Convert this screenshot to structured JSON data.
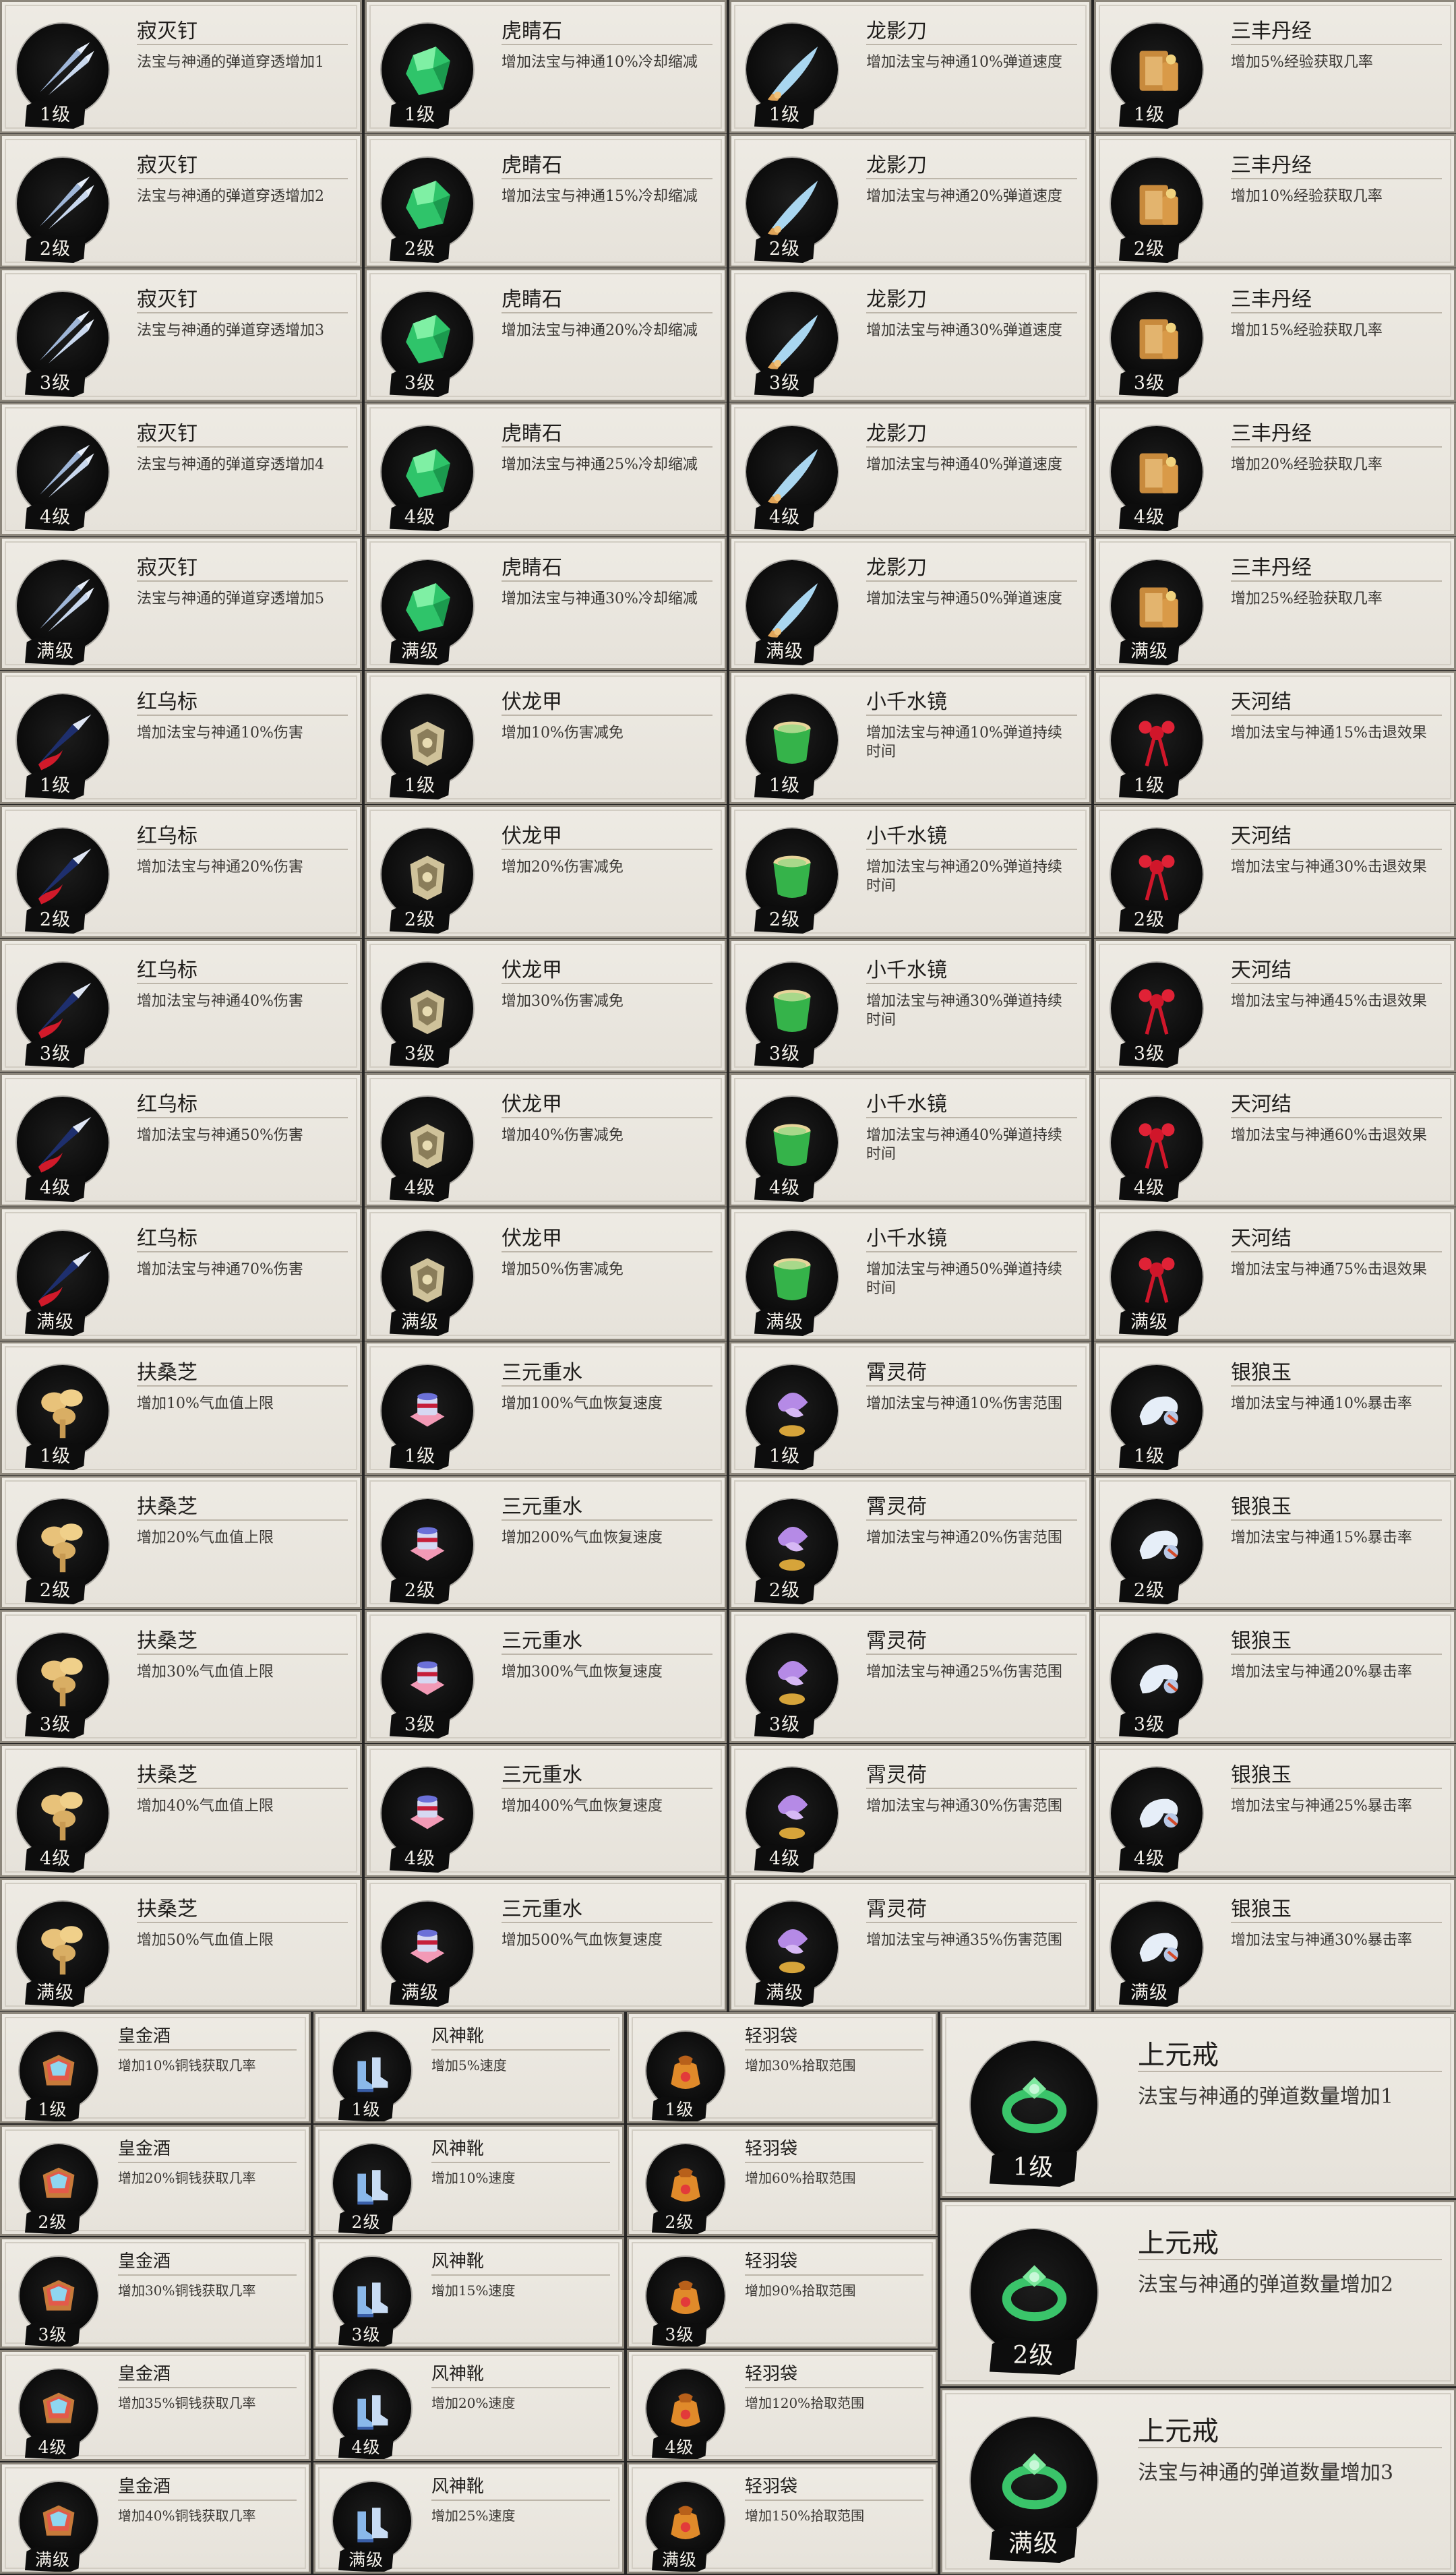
{
  "colors": {
    "sheet_bg": "#262524",
    "card_bg": "#ebe7df",
    "badge_bg": "#0d0d0d",
    "badge_text": "#f4f1ea"
  },
  "groups": [
    {
      "items": [
        {
          "name": "寂灭钉",
          "icon": "spike-darts-icon",
          "levels": [
            {
              "level": "1级",
              "desc": "法宝与神通的弹道穿透增加1"
            },
            {
              "level": "2级",
              "desc": "法宝与神通的弹道穿透增加2"
            },
            {
              "level": "3级",
              "desc": "法宝与神通的弹道穿透增加3"
            },
            {
              "level": "4级",
              "desc": "法宝与神通的弹道穿透增加4"
            },
            {
              "level": "满级",
              "desc": "法宝与神通的弹道穿透增加5"
            }
          ]
        },
        {
          "name": "虎睛石",
          "icon": "green-gem-icon",
          "levels": [
            {
              "level": "1级",
              "desc": "增加法宝与神通10%冷却缩减"
            },
            {
              "level": "2级",
              "desc": "增加法宝与神通15%冷却缩减"
            },
            {
              "level": "3级",
              "desc": "增加法宝与神通20%冷却缩减"
            },
            {
              "level": "4级",
              "desc": "增加法宝与神通25%冷却缩减"
            },
            {
              "level": "满级",
              "desc": "增加法宝与神通30%冷却缩减"
            }
          ]
        },
        {
          "name": "龙影刀",
          "icon": "blade-icon",
          "levels": [
            {
              "level": "1级",
              "desc": "增加法宝与神通10%弹道速度"
            },
            {
              "level": "2级",
              "desc": "增加法宝与神通20%弹道速度"
            },
            {
              "level": "3级",
              "desc": "增加法宝与神通30%弹道速度"
            },
            {
              "level": "4级",
              "desc": "增加法宝与神通40%弹道速度"
            },
            {
              "level": "满级",
              "desc": "增加法宝与神通50%弹道速度"
            }
          ]
        },
        {
          "name": "三丰丹经",
          "icon": "scroll-icon",
          "levels": [
            {
              "level": "1级",
              "desc": "增加5%经验获取几率"
            },
            {
              "level": "2级",
              "desc": "增加10%经验获取几率"
            },
            {
              "level": "3级",
              "desc": "增加15%经验获取几率"
            },
            {
              "level": "4级",
              "desc": "增加20%经验获取几率"
            },
            {
              "level": "满级",
              "desc": "增加25%经验获取几率"
            }
          ]
        }
      ]
    },
    {
      "items": [
        {
          "name": "红乌标",
          "icon": "red-dart-icon",
          "levels": [
            {
              "level": "1级",
              "desc": "增加法宝与神通10%伤害"
            },
            {
              "level": "2级",
              "desc": "增加法宝与神通20%伤害"
            },
            {
              "level": "3级",
              "desc": "增加法宝与神通40%伤害"
            },
            {
              "level": "4级",
              "desc": "增加法宝与神通50%伤害"
            },
            {
              "level": "满级",
              "desc": "增加法宝与神通70%伤害"
            }
          ]
        },
        {
          "name": "伏龙甲",
          "icon": "armor-icon",
          "levels": [
            {
              "level": "1级",
              "desc": "增加10%伤害减免"
            },
            {
              "level": "2级",
              "desc": "增加20%伤害减免"
            },
            {
              "level": "3级",
              "desc": "增加30%伤害减免"
            },
            {
              "level": "4级",
              "desc": "增加40%伤害减免"
            },
            {
              "level": "满级",
              "desc": "增加50%伤害减免"
            }
          ]
        },
        {
          "name": "小千水镜",
          "icon": "water-mirror-icon",
          "levels": [
            {
              "level": "1级",
              "desc": "增加法宝与神通10%弹道持续时间"
            },
            {
              "level": "2级",
              "desc": "增加法宝与神通20%弹道持续时间"
            },
            {
              "level": "3级",
              "desc": "增加法宝与神通30%弹道持续时间"
            },
            {
              "level": "4级",
              "desc": "增加法宝与神通40%弹道持续时间"
            },
            {
              "level": "满级",
              "desc": "增加法宝与神通50%弹道持续时间"
            }
          ]
        },
        {
          "name": "天河结",
          "icon": "red-knot-icon",
          "levels": [
            {
              "level": "1级",
              "desc": "增加法宝与神通15%击退效果"
            },
            {
              "level": "2级",
              "desc": "增加法宝与神通30%击退效果"
            },
            {
              "level": "3级",
              "desc": "增加法宝与神通45%击退效果"
            },
            {
              "level": "4级",
              "desc": "增加法宝与神通60%击退效果"
            },
            {
              "level": "满级",
              "desc": "增加法宝与神通75%击退效果"
            }
          ]
        }
      ]
    },
    {
      "items": [
        {
          "name": "扶桑芝",
          "icon": "mushroom-icon",
          "levels": [
            {
              "level": "1级",
              "desc": "增加10%气血值上限"
            },
            {
              "level": "2级",
              "desc": "增加20%气血值上限"
            },
            {
              "level": "3级",
              "desc": "增加30%气血值上限"
            },
            {
              "level": "4级",
              "desc": "增加40%气血值上限"
            },
            {
              "level": "满级",
              "desc": "增加50%气血值上限"
            }
          ]
        },
        {
          "name": "三元重水",
          "icon": "water-vessel-icon",
          "levels": [
            {
              "level": "1级",
              "desc": "增加100%气血恢复速度"
            },
            {
              "level": "2级",
              "desc": "增加200%气血恢复速度"
            },
            {
              "level": "3级",
              "desc": "增加300%气血恢复速度"
            },
            {
              "level": "4级",
              "desc": "增加400%气血恢复速度"
            },
            {
              "level": "满级",
              "desc": "增加500%气血恢复速度"
            }
          ]
        },
        {
          "name": "霄灵荷",
          "icon": "lotus-icon",
          "levels": [
            {
              "level": "1级",
              "desc": "增加法宝与神通10%伤害范围"
            },
            {
              "level": "2级",
              "desc": "增加法宝与神通20%伤害范围"
            },
            {
              "level": "3级",
              "desc": "增加法宝与神通25%伤害范围"
            },
            {
              "level": "4级",
              "desc": "增加法宝与神通30%伤害范围"
            },
            {
              "level": "满级",
              "desc": "增加法宝与神通35%伤害范围"
            }
          ]
        },
        {
          "name": "银狼玉",
          "icon": "wolf-jade-icon",
          "levels": [
            {
              "level": "1级",
              "desc": "增加法宝与神通10%暴击率"
            },
            {
              "level": "2级",
              "desc": "增加法宝与神通15%暴击率"
            },
            {
              "level": "3级",
              "desc": "增加法宝与神通20%暴击率"
            },
            {
              "level": "4级",
              "desc": "增加法宝与神通25%暴击率"
            },
            {
              "level": "满级",
              "desc": "增加法宝与神通30%暴击率"
            }
          ]
        }
      ]
    },
    {
      "items": [
        {
          "name": "皇金酒",
          "icon": "wine-jar-icon",
          "levels": [
            {
              "level": "1级",
              "desc": "增加10%铜钱获取几率"
            },
            {
              "level": "2级",
              "desc": "增加20%铜钱获取几率"
            },
            {
              "level": "3级",
              "desc": "增加30%铜钱获取几率"
            },
            {
              "level": "4级",
              "desc": "增加35%铜钱获取几率"
            },
            {
              "level": "满级",
              "desc": "增加40%铜钱获取几率"
            }
          ]
        },
        {
          "name": "风神靴",
          "icon": "boots-icon",
          "levels": [
            {
              "level": "1级",
              "desc": "增加5%速度"
            },
            {
              "level": "2级",
              "desc": "增加10%速度"
            },
            {
              "level": "3级",
              "desc": "增加15%速度"
            },
            {
              "level": "4级",
              "desc": "增加20%速度"
            },
            {
              "level": "满级",
              "desc": "增加25%速度"
            }
          ]
        },
        {
          "name": "轻羽袋",
          "icon": "pouch-icon",
          "levels": [
            {
              "level": "1级",
              "desc": "增加30%拾取范围"
            },
            {
              "level": "2级",
              "desc": "增加60%拾取范围"
            },
            {
              "level": "3级",
              "desc": "增加90%拾取范围"
            },
            {
              "level": "4级",
              "desc": "增加120%拾取范围"
            },
            {
              "level": "满级",
              "desc": "增加150%拾取范围"
            }
          ]
        },
        {
          "name": "上元戒",
          "icon": "jade-ring-icon",
          "levels": [
            {
              "level": "1级",
              "desc": "法宝与神通的弹道数量增加1"
            },
            {
              "level": "2级",
              "desc": "法宝与神通的弹道数量增加2"
            },
            {
              "level": "满级",
              "desc": "法宝与神通的弹道数量增加3"
            }
          ]
        }
      ]
    }
  ]
}
